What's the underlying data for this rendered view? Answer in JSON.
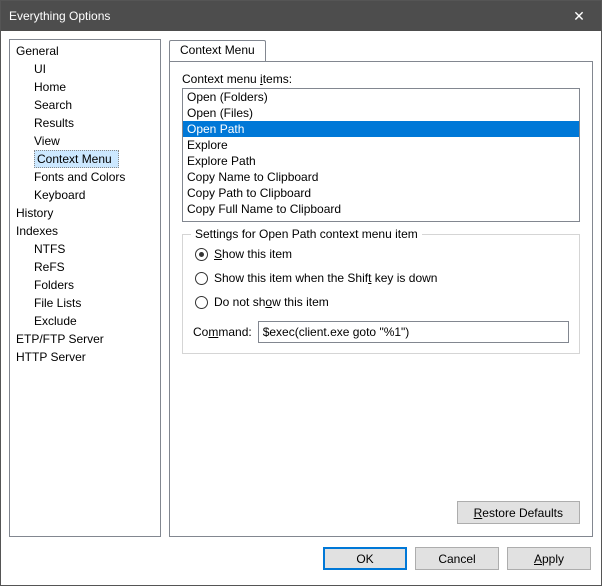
{
  "window": {
    "title": "Everything Options",
    "close_glyph": "✕"
  },
  "tree": {
    "items": [
      {
        "label": "General",
        "level": 0
      },
      {
        "label": "UI",
        "level": 1
      },
      {
        "label": "Home",
        "level": 1
      },
      {
        "label": "Search",
        "level": 1
      },
      {
        "label": "Results",
        "level": 1
      },
      {
        "label": "View",
        "level": 1
      },
      {
        "label": "Context Menu",
        "level": 1,
        "selected": true
      },
      {
        "label": "Fonts and Colors",
        "level": 1
      },
      {
        "label": "Keyboard",
        "level": 1
      },
      {
        "label": "History",
        "level": 0
      },
      {
        "label": "Indexes",
        "level": 0
      },
      {
        "label": "NTFS",
        "level": 1
      },
      {
        "label": "ReFS",
        "level": 1
      },
      {
        "label": "Folders",
        "level": 1
      },
      {
        "label": "File Lists",
        "level": 1
      },
      {
        "label": "Exclude",
        "level": 1
      },
      {
        "label": "ETP/FTP Server",
        "level": 0
      },
      {
        "label": "HTTP Server",
        "level": 0
      }
    ]
  },
  "tab": {
    "label": "Context Menu"
  },
  "list": {
    "label_pre": "Context menu ",
    "label_hot": "i",
    "label_post": "tems:",
    "items": [
      {
        "label": "Open (Folders)"
      },
      {
        "label": "Open (Files)"
      },
      {
        "label": "Open Path",
        "selected": true
      },
      {
        "label": "Explore"
      },
      {
        "label": "Explore Path"
      },
      {
        "label": "Copy Name to Clipboard"
      },
      {
        "label": "Copy Path to Clipboard"
      },
      {
        "label": "Copy Full Name to Clipboard"
      }
    ]
  },
  "settings": {
    "legend": "Settings for Open Path context menu item",
    "radios": [
      {
        "pre": "",
        "hot": "S",
        "post": "how this item",
        "checked": true
      },
      {
        "pre": "Show this item when the Shif",
        "hot": "t",
        "post": " key is down",
        "checked": false
      },
      {
        "pre": "Do not sh",
        "hot": "o",
        "post": "w this item",
        "checked": false
      }
    ],
    "command_label_pre": "Co",
    "command_label_hot": "m",
    "command_label_post": "mand:",
    "command_value": "$exec(client.exe goto \"%1\")"
  },
  "buttons": {
    "restore_pre": "",
    "restore_hot": "R",
    "restore_post": "estore Defaults",
    "ok": "OK",
    "cancel": "Cancel",
    "apply_pre": "",
    "apply_hot": "A",
    "apply_post": "pply"
  }
}
